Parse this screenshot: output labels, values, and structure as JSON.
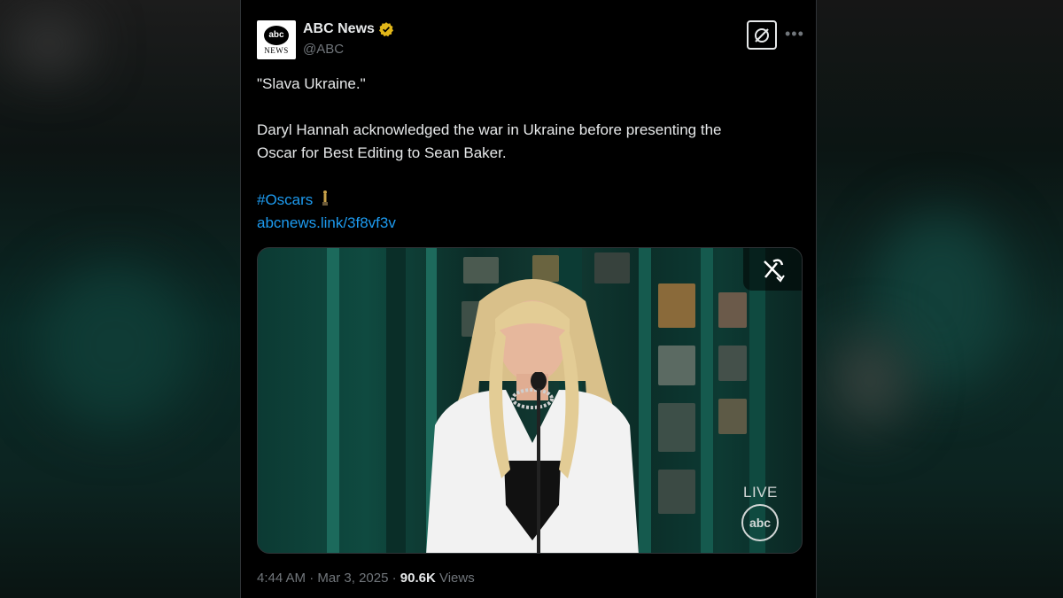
{
  "author": {
    "name": "ABC News",
    "handle": "@ABC",
    "avatar_line1": "abc",
    "avatar_line2": "NEWS",
    "verified": true
  },
  "tweet": {
    "quote": "\"Slava Ukraine.\"",
    "body_line1": "Daryl Hannah acknowledged the war in Ukraine before presenting the",
    "body_line2": "Oscar for Best Editing to Sean Baker.",
    "hashtag": "#Oscars",
    "hashtag_emoji": "oscar-statuette",
    "link": "abcnews.link/3f8vf3v"
  },
  "media": {
    "live_label": "LIVE",
    "network_bug": "abc",
    "overlay_icon": "crossed-out-wrench-icon"
  },
  "meta": {
    "time": "4:44 AM",
    "separator": "·",
    "date": "Mar 3, 2025",
    "views_count": "90.6K",
    "views_label": "Views"
  },
  "colors": {
    "background": "#000000",
    "text": "#e7e9ea",
    "muted": "#71767b",
    "link": "#1d9bf0",
    "verified_gold": "#e2b719",
    "stage_teal": "#0f4a40"
  }
}
